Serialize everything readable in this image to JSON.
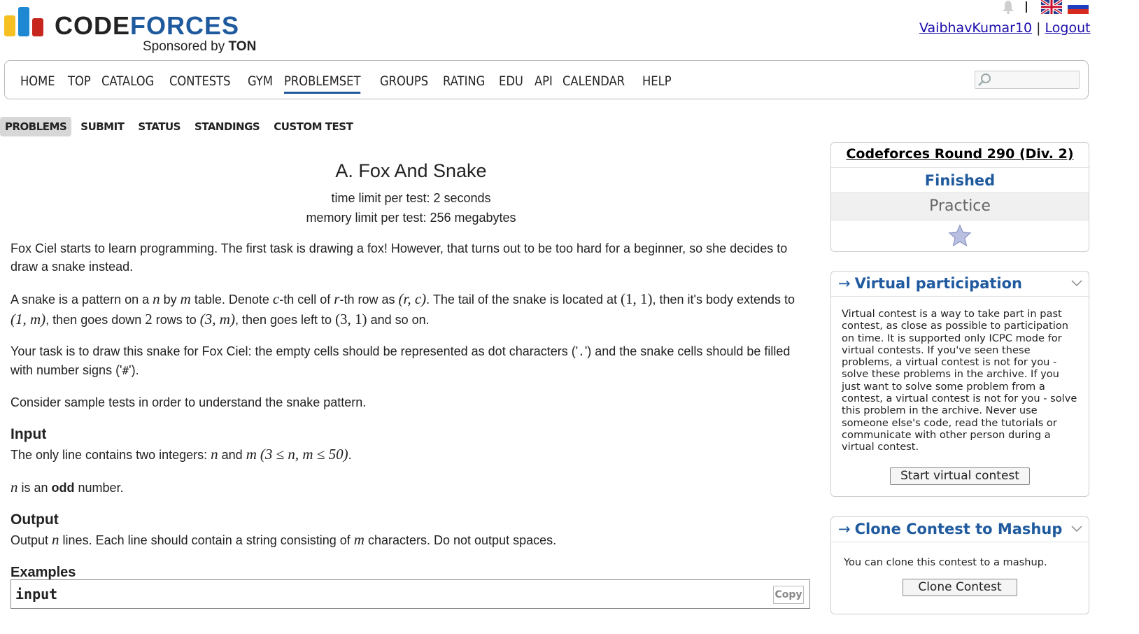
{
  "header": {
    "logo_part1": "CODE",
    "logo_part2": "FORCES",
    "sponsor_prefix": "Sponsored by",
    "sponsor_name": "TON",
    "username": "VaibhavKumar10",
    "separator": "|",
    "logout": "Logout"
  },
  "colors": {
    "brand_blue": "#1f5a9e",
    "bar_yellow": "#f6c022",
    "bar_blue": "#1e88d3",
    "bar_red": "#c6261e"
  },
  "main_nav": {
    "items": [
      "HOME",
      "TOP",
      "CATALOG",
      "CONTESTS",
      "GYM",
      "PROBLEMSET",
      "GROUPS",
      "RATING",
      "EDU",
      "API",
      "CALENDAR",
      "HELP"
    ],
    "active": "PROBLEMSET"
  },
  "sub_nav": {
    "items": [
      "PROBLEMS",
      "SUBMIT",
      "STATUS",
      "STANDINGS",
      "CUSTOM TEST"
    ],
    "active": "PROBLEMS"
  },
  "problem": {
    "title": "A. Fox And Snake",
    "time_limit": "time limit per test: 2 seconds",
    "memory_limit": "memory limit per test: 256 megabytes",
    "intro": "Fox Ciel starts to learn programming. The first task is drawing a fox! However, that turns out to be too hard for a beginner, so she decides to draw a snake instead.",
    "pattern_a": "A snake is a pattern on a ",
    "pattern_b": " by ",
    "pattern_c": " table. Denote ",
    "pattern_d": "-th cell of ",
    "pattern_e": "-th row as ",
    "pattern_f": ". The tail of the snake is located at ",
    "pattern_g": ", then it's body extends to ",
    "pattern_h": ", then goes down ",
    "pattern_i": " rows to ",
    "pattern_j": ", then goes left to ",
    "pattern_k": " and so on.",
    "task_a": "Your task is to draw this snake for Fox Ciel: the empty cells should be represented as dot characters ('",
    "task_dot": ".",
    "task_b": "') and the snake cells should be filled with number signs ('",
    "task_hash": "#",
    "task_c": "').",
    "consider": "Consider sample tests in order to understand the snake pattern.",
    "input_title": "Input",
    "input_a": "The only line contains two integers: ",
    "input_b": " and ",
    "input_c": ".",
    "odd_a": " is an ",
    "odd_b": "odd",
    "odd_c": " number.",
    "output_title": "Output",
    "output_a": "Output ",
    "output_b": " lines. Each line should contain a string consisting of ",
    "output_c": " characters. Do not output spaces.",
    "examples_title": "Examples",
    "example_input_label": "input",
    "copy_label": "Copy",
    "math": {
      "n": "n",
      "m": "m",
      "c": "c",
      "r": "r",
      "rc": "(r, c)",
      "one_one": "(1, 1)",
      "one_m": "(1, m)",
      "two": "2",
      "three_m": "(3, m)",
      "three_one": "(3, 1)",
      "constraint": "(3 ≤ n, m ≤ 50)"
    }
  },
  "sidebar": {
    "contest_name": "Codeforces Round 290 (Div. 2)",
    "phase": "Finished",
    "practice": "Practice",
    "virtual": {
      "arrow": "→",
      "title": "Virtual participation",
      "body": "Virtual contest is a way to take part in past contest, as close as possible to participation on time. It is supported only ICPC mode for virtual contests. If you've seen these problems, a virtual contest is not for you - solve these problems in the archive. If you just want to solve some problem from a contest, a virtual contest is not for you - solve this problem in the archive. Never use someone else's code, read the tutorials or communicate with other person during a virtual contest.",
      "button": "Start virtual contest"
    },
    "clone": {
      "arrow": "→",
      "title": "Clone Contest to Mashup",
      "body": "You can clone this contest to a mashup.",
      "button": "Clone Contest"
    }
  },
  "icons": [
    "bell-icon",
    "uk-flag-icon",
    "ru-flag-icon",
    "search-icon",
    "star-icon",
    "chevron-down-icon"
  ]
}
